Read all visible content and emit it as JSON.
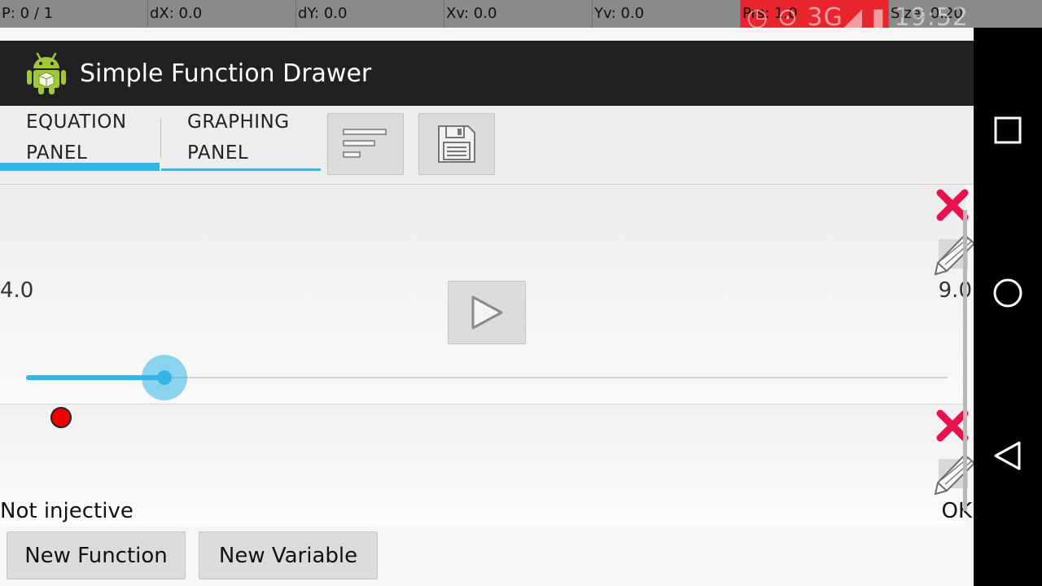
{
  "pointer_overlay": {
    "p": "P: 0 / 1",
    "dx": "dX: 0.0",
    "dy": "dY: 0.0",
    "xv": "Xv: 0.0",
    "yv": "Yv: 0.0",
    "prs": "Prs: 1.0",
    "size": "Size: 0.20"
  },
  "status_bar": {
    "text": "◷ ⊙ 3G◢ ▮ 19:52"
  },
  "action_bar": {
    "title": "Simple Function Drawer",
    "icon": "android-app-icon"
  },
  "tabs": [
    {
      "line1": "EQUATION",
      "line2": "PANEL",
      "selected": true
    },
    {
      "line1": "GRAPHING",
      "line2": "PANEL",
      "selected": false
    }
  ],
  "toolbar": {
    "sort_icon": "sort-lines-icon",
    "save_icon": "floppy-disk-icon"
  },
  "variable": {
    "min_label": "4.0",
    "max_label": "9.0",
    "slider_fraction": 0.15,
    "play_icon": "play-icon",
    "delete_icon": "delete-x-icon",
    "edit_icon": "pencil-edit-icon"
  },
  "function": {
    "color": "#ee0000",
    "status_left": "Not injective",
    "status_right": "OK",
    "delete_icon": "delete-x-icon",
    "edit_icon": "pencil-edit-icon"
  },
  "buttons": {
    "new_function": "New Function",
    "new_variable": "New Variable"
  },
  "nav_bar": {
    "recent_icon": "square-recents-icon",
    "home_icon": "circle-home-icon",
    "back_icon": "triangle-back-icon"
  },
  "colors": {
    "accent": "#33b5e5",
    "action_bar": "#212121",
    "delete": "#e8124f"
  }
}
